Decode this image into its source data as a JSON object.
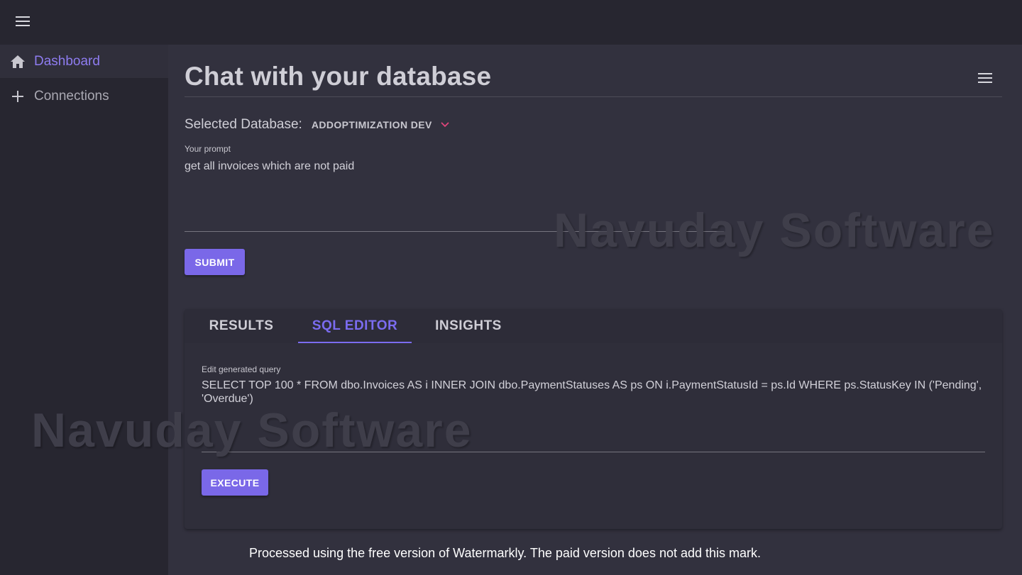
{
  "colors": {
    "accent": "#7a68e8",
    "tab_active": "#7b6cf0",
    "nav_active": "#8e7cf0",
    "dropdown_chevron": "#e0457b",
    "background": "#32313e",
    "sidebar": "#272630"
  },
  "appbar": {
    "menu_icon": "hamburger-menu-icon"
  },
  "sidebar": {
    "items": [
      {
        "label": "Dashboard",
        "icon": "home-icon",
        "active": true
      },
      {
        "label": "Connections",
        "icon": "plus-icon",
        "active": false
      }
    ]
  },
  "main": {
    "title": "Chat with your database",
    "title_menu_icon": "hamburger-menu-icon",
    "database": {
      "label": "Selected Database:",
      "selected": "ADDOPTIMIZATION DEV",
      "chevron_icon": "chevron-down-icon"
    },
    "prompt": {
      "label": "Your prompt",
      "value": "get all invoices which are not paid"
    },
    "submit_label": "SUBMIT",
    "tabs": [
      {
        "label": "RESULTS",
        "active": false
      },
      {
        "label": "SQL EDITOR",
        "active": true
      },
      {
        "label": "INSIGHTS",
        "active": false
      }
    ],
    "sql_editor": {
      "label": "Edit generated query",
      "query": "SELECT TOP 100 * FROM dbo.Invoices AS i INNER JOIN dbo.PaymentStatuses AS ps ON i.PaymentStatusId = ps.Id WHERE ps.StatusKey IN ('Pending', 'Overdue')",
      "execute_label": "EXECUTE"
    }
  },
  "watermarks": {
    "text": "Navuday Software",
    "footer_note": "Processed using the free version of Watermarkly. The paid version does not add this mark."
  }
}
